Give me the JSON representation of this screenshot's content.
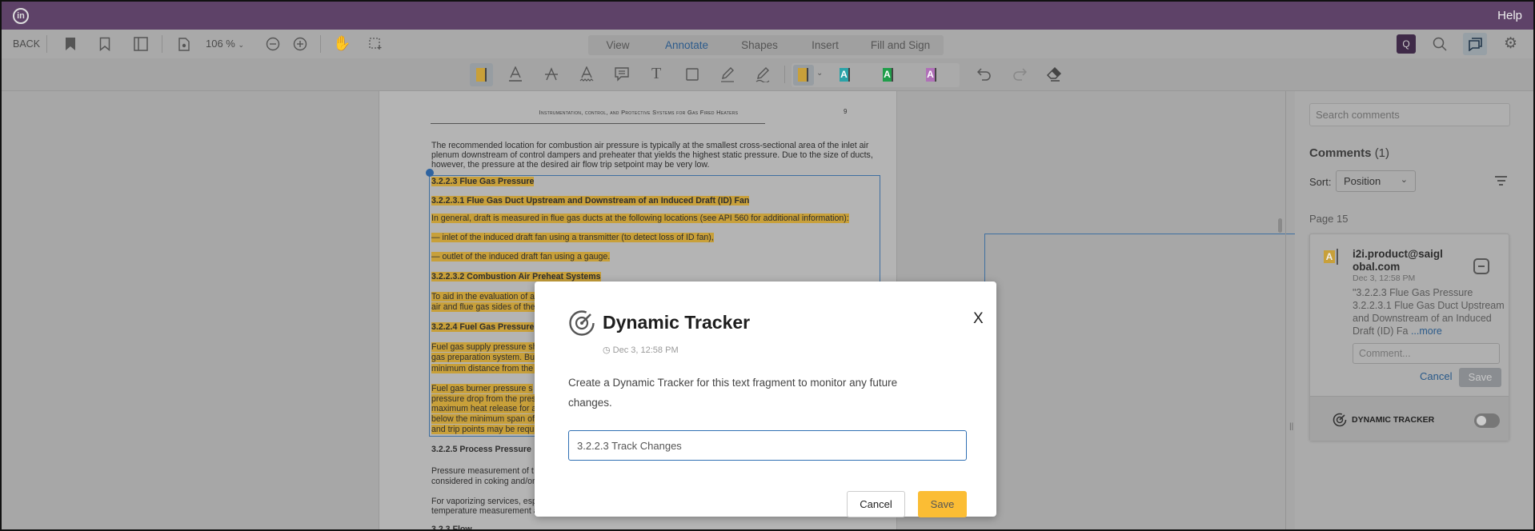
{
  "topbar": {
    "logo": "in",
    "help": "Help"
  },
  "toolbar": {
    "back": "BACK",
    "zoom": "106 %",
    "icons": [
      "bookmark-filled-icon",
      "bookmark-outline-icon",
      "side-panel-icon",
      "document-settings-icon",
      "zoom-out-icon",
      "zoom-in-icon",
      "hand-icon",
      "marquee-select-icon"
    ],
    "tabs": [
      {
        "label": "View"
      },
      {
        "label": "Annotate",
        "active": true
      },
      {
        "label": "Shapes"
      },
      {
        "label": "Insert"
      },
      {
        "label": "Fill and Sign"
      }
    ],
    "right_icons": [
      "new-comment-search-icon",
      "search-icon",
      "comments-icon",
      "gear-icon"
    ]
  },
  "annotate_toolbar": {
    "tools": [
      "highlight-icon",
      "underline-icon",
      "strikeout-icon",
      "squiggly-icon",
      "note-icon",
      "text-icon",
      "rectangle-icon",
      "pen-icon",
      "signature-icon"
    ],
    "highlight_colors": [
      "#c8a03a",
      "#2aa3a8",
      "#1f9e4a",
      "#b070b8"
    ],
    "letter": "A",
    "actions": [
      "undo-icon",
      "redo-icon",
      "eraser-icon"
    ]
  },
  "document": {
    "header": "Instrumentation, control, and Protective Systems for Gas Fired Heaters",
    "page_number": "9",
    "lines": [
      {
        "text": "The recommended location for combustion air pressure is typically at the smallest cross-sectional area of the inlet air",
        "hl": false,
        "bold": false
      },
      {
        "text": "plenum downstream of control dampers and preheater that yields the highest static pressure. Due to the size of ducts,",
        "hl": false,
        "bold": false
      },
      {
        "text": "however, the pressure at the desired air flow trip setpoint may be very low.",
        "hl": false,
        "bold": false
      },
      {
        "text": "3.2.2.3    Flue Gas Pressure",
        "hl": true,
        "bold": true
      },
      {
        "text": "3.2.2.3.1    Flue Gas Duct Upstream and Downstream of an Induced Draft (ID) Fan",
        "hl": true,
        "bold": true
      },
      {
        "text": "In general, draft is measured in flue gas ducts at the following locations (see API 560 for additional information):",
        "hl": true,
        "bold": false
      },
      {
        "text": "—    inlet of the induced draft fan using a transmitter (to detect loss of ID fan),",
        "hl": true,
        "bold": false
      },
      {
        "text": "—    outlet of the induced draft fan using a gauge.",
        "hl": true,
        "bold": false
      },
      {
        "text": "3.2.2.3.2    Combustion Air Preheat Systems",
        "hl": true,
        "bold": true
      },
      {
        "text": "To aid in the evaluation of a",
        "hl": true,
        "bold": false
      },
      {
        "text": "air and flue gas sides of the",
        "hl": true,
        "bold": false
      },
      {
        "text": "3.2.2.4    Fuel Gas Pressure",
        "hl": true,
        "bold": true
      },
      {
        "text": "Fuel gas supply pressure sh",
        "hl": true,
        "bold": false
      },
      {
        "text": "gas preparation system. Bu",
        "hl": true,
        "bold": false
      },
      {
        "text": "minimum distance from the c",
        "hl": true,
        "bold": false
      },
      {
        "text": "Fuel gas burner pressure s",
        "hl": true,
        "bold": false
      },
      {
        "text": "pressure drop from the pres",
        "hl": true,
        "bold": false
      },
      {
        "text": "maximum heat release for al",
        "hl": true,
        "bold": false
      },
      {
        "text": "below the minimum span of t",
        "hl": true,
        "bold": false
      },
      {
        "text": "and trip points may be requir",
        "hl": true,
        "bold": false
      },
      {
        "text": "3.2.2.5    Process Pressure",
        "hl": false,
        "bold": true
      },
      {
        "text": "Pressure measurement of t",
        "hl": false,
        "bold": false
      },
      {
        "text": "considered in coking and/or",
        "hl": false,
        "bold": false
      },
      {
        "text": "For vaporizing services, esp",
        "hl": false,
        "bold": false
      },
      {
        "text": "temperature measurement a",
        "hl": false,
        "bold": false
      },
      {
        "text": "3.2.3    Flow",
        "hl": false,
        "bold": true
      }
    ]
  },
  "comments_panel": {
    "search_placeholder": "Search comments",
    "title": "Comments",
    "count": "(1)",
    "sort_label": "Sort:",
    "sort_value": "Position",
    "page_label": "Page 15",
    "comment": {
      "author": "i2i.product@saiglobal.com",
      "date": "Dec 3, 12:58 PM",
      "quote": "\"3.2.2.3 Flue Gas Pressure 3.2.2.3.1 Flue Gas Duct Upstream and Downstream of an Induced Draft (ID) Fa",
      "more": "...more",
      "input_placeholder": "Comment...",
      "cancel": "Cancel",
      "save": "Save",
      "tracker_label": "DYNAMIC TRACKER",
      "tracker_enabled": false
    }
  },
  "modal": {
    "title": "Dynamic Tracker",
    "date": "Dec 3, 12:58 PM",
    "description": "Create a Dynamic Tracker for this text fragment to monitor any future changes.",
    "input_value": "3.2.2.3 Track Changes",
    "close": "X",
    "cancel": "Cancel",
    "save": "Save"
  }
}
